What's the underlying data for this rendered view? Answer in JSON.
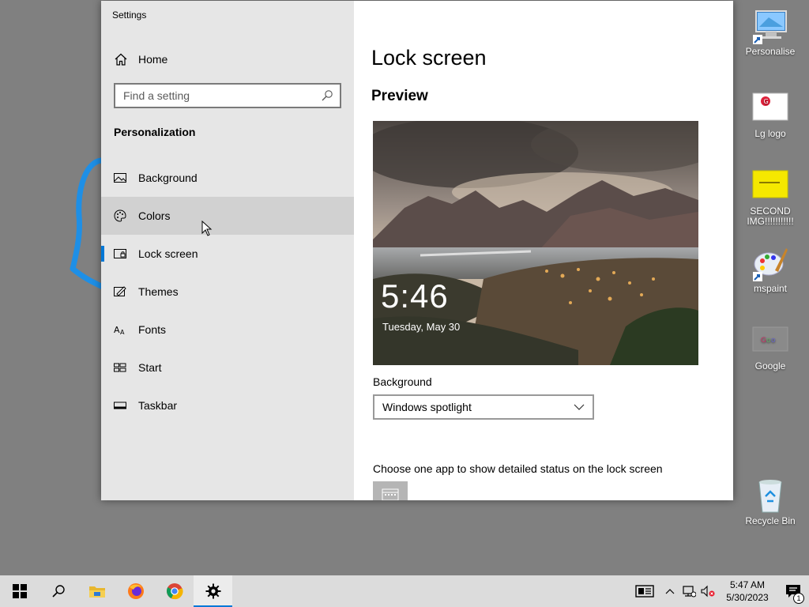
{
  "window": {
    "title": "Settings",
    "minimize_icon": "minimize-icon",
    "maximize_icon": "maximize-icon",
    "close_icon": "close-icon"
  },
  "sidebar": {
    "home_label": "Home",
    "search_placeholder": "Find a setting",
    "section_heading": "Personalization",
    "items": [
      {
        "label": "Background",
        "icon": "picture-icon"
      },
      {
        "label": "Colors",
        "icon": "palette-icon"
      },
      {
        "label": "Lock screen",
        "icon": "lock-screen-icon"
      },
      {
        "label": "Themes",
        "icon": "themes-icon"
      },
      {
        "label": "Fonts",
        "icon": "fonts-icon"
      },
      {
        "label": "Start",
        "icon": "start-icon"
      },
      {
        "label": "Taskbar",
        "icon": "taskbar-icon"
      }
    ],
    "selected": "Lock screen",
    "hovered": "Colors"
  },
  "main": {
    "page_title": "Lock screen",
    "preview_heading": "Preview",
    "preview_time": "5:46",
    "preview_date": "Tuesday, May 30",
    "background_label": "Background",
    "background_value": "Windows spotlight",
    "status_label": "Choose one app to show detailed status on the lock screen"
  },
  "desktop_icons": [
    {
      "label": "Personalise",
      "icon": "monitor-shortcut-icon"
    },
    {
      "label": "Lg logo",
      "icon": "image-file-icon"
    },
    {
      "label": "SECOND IMG!!!!!!!!!!!",
      "icon": "image-file-icon"
    },
    {
      "label": "mspaint",
      "icon": "paint-icon"
    },
    {
      "label": "Google",
      "icon": "image-file-icon"
    },
    {
      "label": "Recycle Bin",
      "icon": "recycle-bin-icon"
    }
  ],
  "taskbar": {
    "apps": [
      "start-icon",
      "search-icon",
      "file-explorer-icon",
      "firefox-icon",
      "chrome-icon",
      "settings-icon"
    ],
    "active_app": "settings-icon",
    "clock_time": "5:47 AM",
    "clock_date": "5/30/2023",
    "notification_count": "1"
  },
  "colors": {
    "accent": "#0078d7",
    "sidebar_bg": "#e6e6e6",
    "desktop_bg": "#808080",
    "taskbar_bg": "#dcdcdc"
  }
}
